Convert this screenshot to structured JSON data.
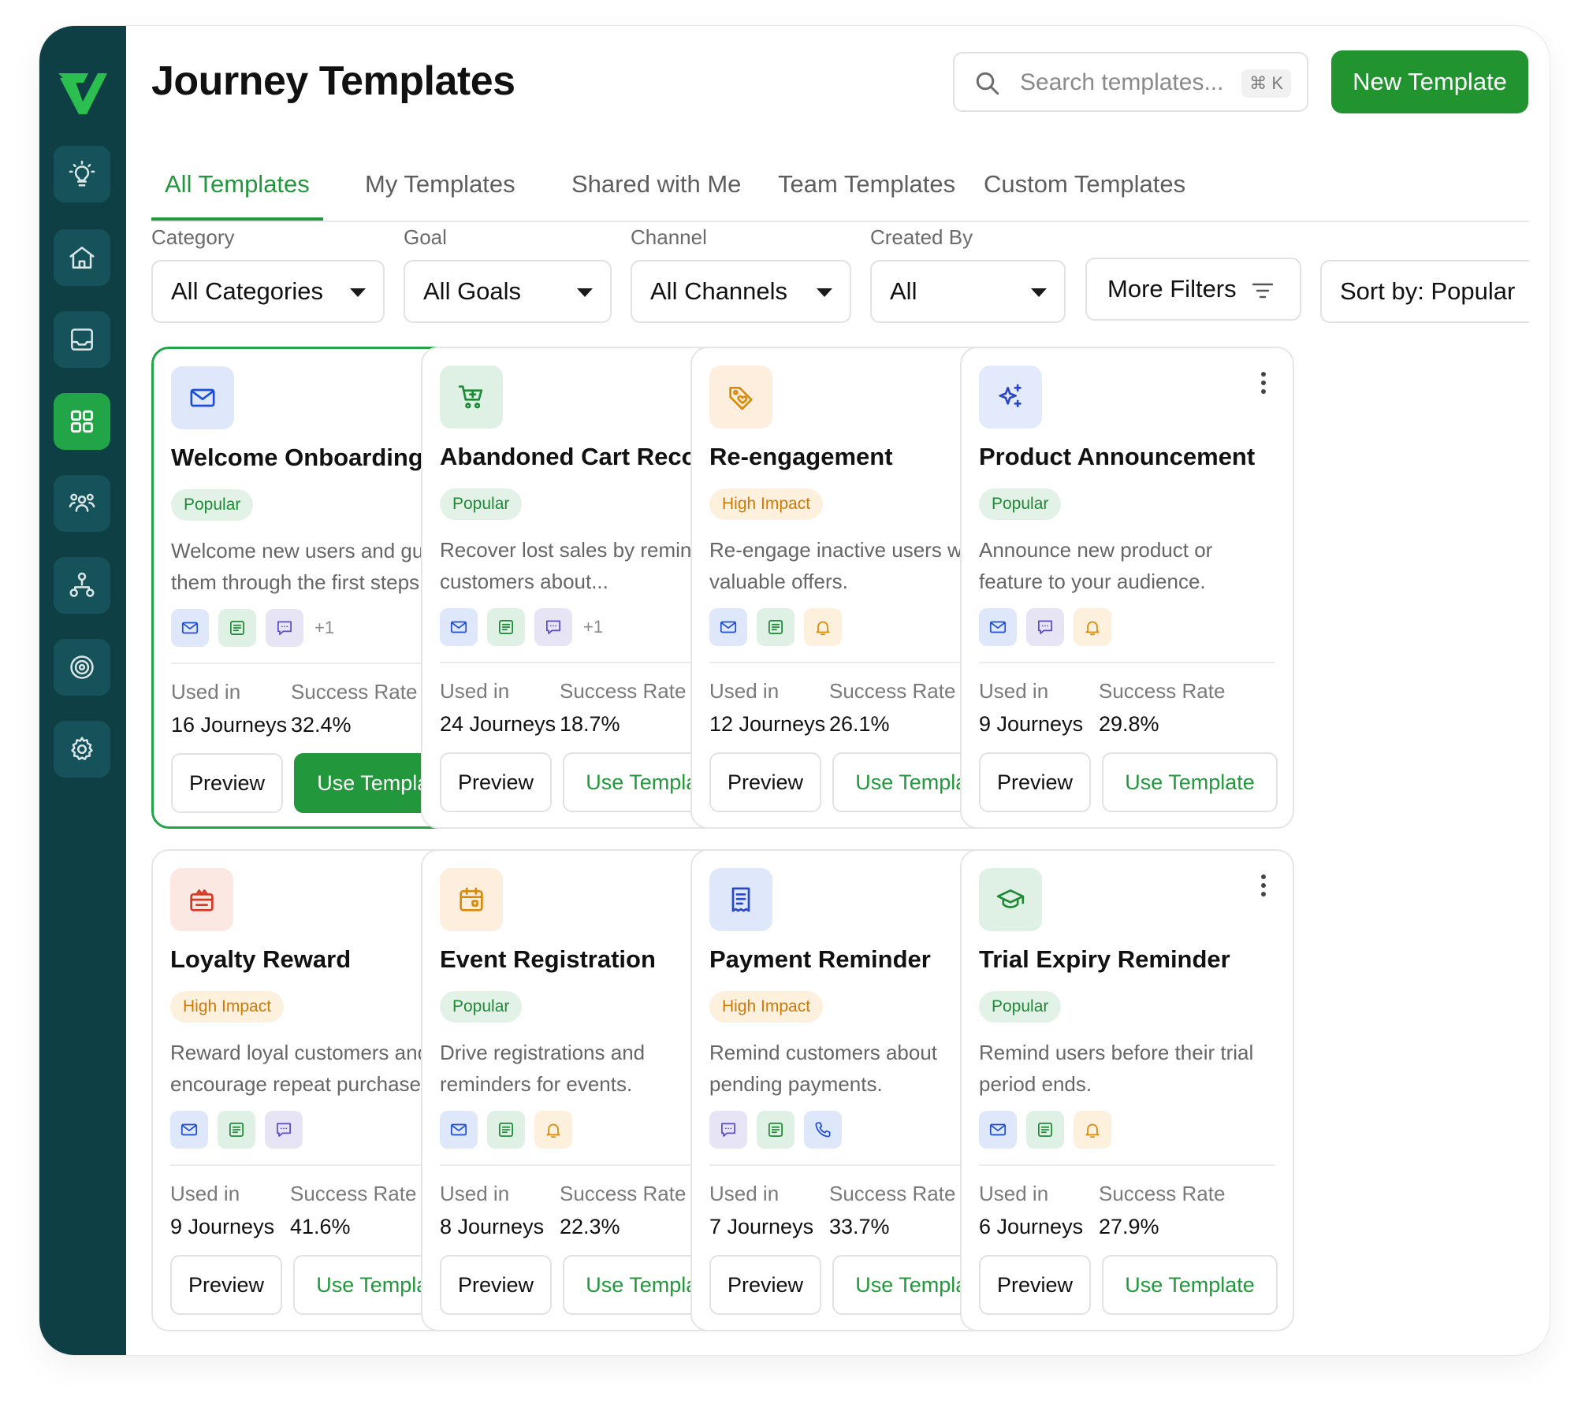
{
  "app": {
    "title": "Journey Templates"
  },
  "header": {
    "search_placeholder": "Search templates...",
    "search_shortcut": "⌘ K",
    "new_button": "New Template"
  },
  "tabs": [
    {
      "label": "All Templates",
      "active": true
    },
    {
      "label": "My Templates",
      "active": false
    },
    {
      "label": "Shared with Me",
      "active": false
    },
    {
      "label": "Team Templates",
      "active": false
    },
    {
      "label": "Custom Templates",
      "active": false
    }
  ],
  "filters": {
    "category": {
      "label": "Category",
      "value": "All Categories"
    },
    "goal": {
      "label": "Goal",
      "value": "All Goals"
    },
    "channel": {
      "label": "Channel",
      "value": "All Channels"
    },
    "created_by": {
      "label": "Created By",
      "value": "All"
    },
    "more_filters": "More Filters",
    "sort": "Sort by: Popular"
  },
  "sidebar": {
    "items": [
      {
        "name": "lightbulb-icon",
        "active": false
      },
      {
        "name": "home-icon",
        "active": false
      },
      {
        "name": "inbox-icon",
        "active": false
      },
      {
        "name": "grid-icon",
        "active": true
      },
      {
        "name": "users-icon",
        "active": false
      },
      {
        "name": "hierarchy-icon",
        "active": false
      },
      {
        "name": "target-icon",
        "active": false
      },
      {
        "name": "gear-icon",
        "active": false
      }
    ]
  },
  "labels": {
    "used_in": "Used in",
    "success_rate": "Success Rate",
    "preview": "Preview",
    "use_template": "Use Template"
  },
  "colors": {
    "sidebar_bg": "#0e3f45",
    "accent_green": "#23973b",
    "popular_badge": "#1f8a36",
    "impact_badge": "#cf7a05"
  },
  "templates": [
    {
      "title": "Welcome Onboarding",
      "badge": "Popular",
      "desc": "Welcome new users and guide them through the first steps.",
      "icon": "envelope-icon",
      "channels": [
        "email-icon",
        "sms-icon",
        "chat-icon"
      ],
      "extra": "+1",
      "used": "16 Journeys",
      "rate": "32.4%",
      "selected": true
    },
    {
      "title": "Abandoned Cart Recovery",
      "badge": "Popular",
      "desc": "Recover lost sales by reminding customers about...",
      "icon": "cart-icon",
      "channels": [
        "email-icon",
        "sms-icon",
        "chat-icon"
      ],
      "extra": "+1",
      "used": "24 Journeys",
      "rate": "18.7%",
      "selected": false
    },
    {
      "title": "Re-engagement",
      "badge": "High Impact",
      "desc": "Re-engage inactive users with valuable offers.",
      "icon": "tag-icon",
      "channels": [
        "email-icon",
        "sms-icon",
        "bell-icon"
      ],
      "extra": "",
      "used": "12 Journeys",
      "rate": "26.1%",
      "selected": false
    },
    {
      "title": "Product Announcement",
      "badge": "Popular",
      "desc": "Announce new product or feature to your audience.",
      "icon": "sparkle-icon",
      "channels": [
        "email-icon",
        "chat-icon",
        "bell-icon"
      ],
      "extra": "",
      "used": "9 Journeys",
      "rate": "29.8%",
      "selected": false
    },
    {
      "title": "Loyalty Reward",
      "badge": "High Impact",
      "desc": "Reward loyal customers and encourage repeat purchases.",
      "icon": "gift-icon",
      "channels": [
        "email-icon",
        "sms-icon",
        "chat-icon"
      ],
      "extra": "",
      "used": "9 Journeys",
      "rate": "41.6%",
      "selected": false
    },
    {
      "title": "Event Registration",
      "badge": "Popular",
      "desc": "Drive registrations and reminders for events.",
      "icon": "calendar-icon",
      "channels": [
        "email-icon",
        "sms-icon",
        "bell-icon"
      ],
      "extra": "",
      "used": "8 Journeys",
      "rate": "22.3%",
      "selected": false
    },
    {
      "title": "Payment Reminder",
      "badge": "High Impact",
      "desc": "Remind customers about pending payments.",
      "icon": "receipt-icon",
      "channels": [
        "chat-icon",
        "sms-icon",
        "phone-icon"
      ],
      "extra": "",
      "used": "7 Journeys",
      "rate": "33.7%",
      "selected": false
    },
    {
      "title": "Trial Expiry Reminder",
      "badge": "Popular",
      "desc": "Remind users before their trial period ends.",
      "icon": "graduation-cap-icon",
      "channels": [
        "email-icon",
        "sms-icon",
        "bell-icon"
      ],
      "extra": "",
      "used": "6 Journeys",
      "rate": "27.9%",
      "selected": false
    }
  ]
}
